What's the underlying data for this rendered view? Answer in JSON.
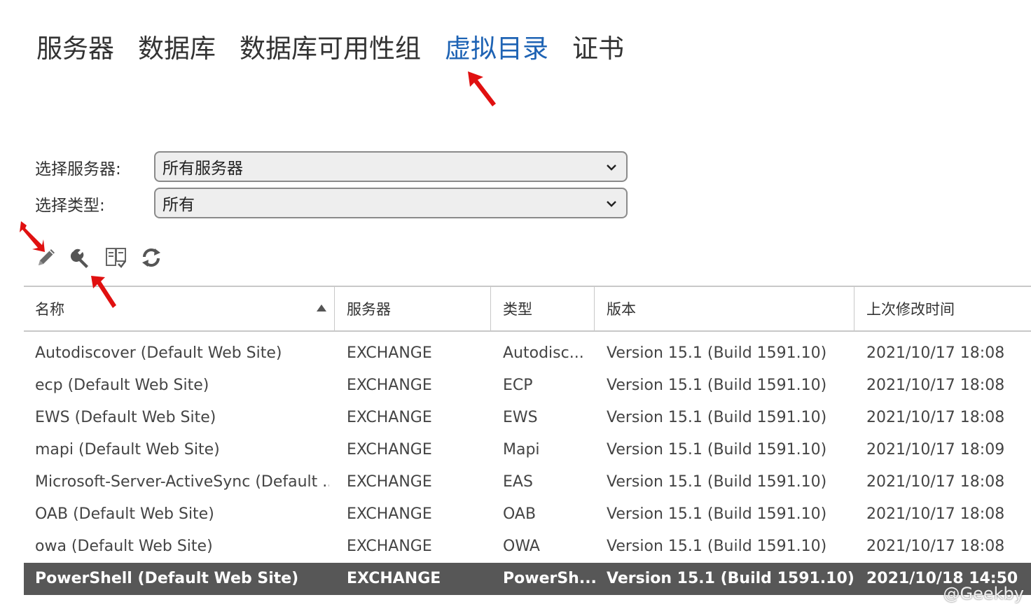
{
  "nav": {
    "tabs": [
      {
        "label": "服务器"
      },
      {
        "label": "数据库"
      },
      {
        "label": "数据库可用性组"
      },
      {
        "label": "虚拟目录",
        "active": true
      },
      {
        "label": "证书"
      }
    ]
  },
  "filters": {
    "server_label": "选择服务器:",
    "server_value": "所有服务器",
    "type_label": "选择类型:",
    "type_value": "所有"
  },
  "toolbar": {
    "icons": [
      "edit-pencil-icon",
      "configure-wrench-icon",
      "reset-virtual-directory-icon",
      "refresh-icon"
    ]
  },
  "table": {
    "columns": [
      "名称",
      "服务器",
      "类型",
      "版本",
      "上次修改时间"
    ],
    "sort_column": "名称",
    "sort_direction": "ascending",
    "rows": [
      {
        "name": "Autodiscover (Default Web Site)",
        "server": "EXCHANGE",
        "type": "Autodisc...",
        "version": "Version 15.1 (Build 1591.10)",
        "modified": "2021/10/17 18:08"
      },
      {
        "name": "ecp (Default Web Site)",
        "server": "EXCHANGE",
        "type": "ECP",
        "version": "Version 15.1 (Build 1591.10)",
        "modified": "2021/10/17 18:08"
      },
      {
        "name": "EWS (Default Web Site)",
        "server": "EXCHANGE",
        "type": "EWS",
        "version": "Version 15.1 (Build 1591.10)",
        "modified": "2021/10/17 18:08"
      },
      {
        "name": "mapi (Default Web Site)",
        "server": "EXCHANGE",
        "type": "Mapi",
        "version": "Version 15.1 (Build 1591.10)",
        "modified": "2021/10/17 18:09"
      },
      {
        "name": "Microsoft-Server-ActiveSync (Default ...",
        "server": "EXCHANGE",
        "type": "EAS",
        "version": "Version 15.1 (Build 1591.10)",
        "modified": "2021/10/17 18:08"
      },
      {
        "name": "OAB (Default Web Site)",
        "server": "EXCHANGE",
        "type": "OAB",
        "version": "Version 15.1 (Build 1591.10)",
        "modified": "2021/10/17 18:08"
      },
      {
        "name": "owa (Default Web Site)",
        "server": "EXCHANGE",
        "type": "OWA",
        "version": "Version 15.1 (Build 1591.10)",
        "modified": "2021/10/17 18:08"
      },
      {
        "name": "PowerShell (Default Web Site)",
        "server": "EXCHANGE",
        "type": "PowerSh...",
        "version": "Version 15.1 (Build 1591.10)",
        "modified": "2021/10/18 14:50",
        "selected": true
      }
    ]
  },
  "colors": {
    "active_tab": "#1e63b4",
    "selected_row": "#575757",
    "annotation_arrow": "#e01010"
  },
  "watermark": "@Geekby"
}
